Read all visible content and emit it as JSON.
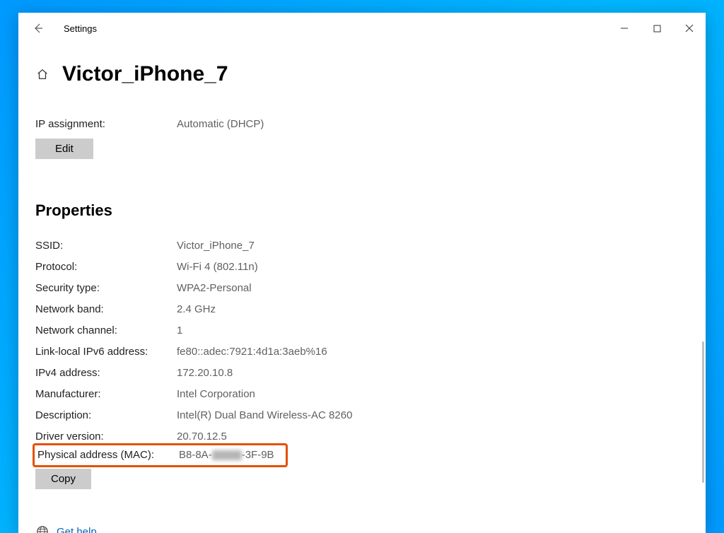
{
  "window": {
    "app_title": "Settings"
  },
  "header": {
    "page_title": "Victor_iPhone_7"
  },
  "ip_assignment": {
    "label": "IP assignment:",
    "value": "Automatic (DHCP)",
    "edit_button": "Edit"
  },
  "properties_heading": "Properties",
  "properties": [
    {
      "label": "SSID:",
      "value": "Victor_iPhone_7"
    },
    {
      "label": "Protocol:",
      "value": "Wi-Fi 4 (802.11n)"
    },
    {
      "label": "Security type:",
      "value": "WPA2-Personal"
    },
    {
      "label": "Network band:",
      "value": "2.4 GHz"
    },
    {
      "label": "Network channel:",
      "value": "1"
    },
    {
      "label": "Link-local IPv6 address:",
      "value": "fe80::adec:7921:4d1a:3aeb%16"
    },
    {
      "label": "IPv4 address:",
      "value": "172.20.10.8"
    },
    {
      "label": "Manufacturer:",
      "value": "Intel Corporation"
    },
    {
      "label": "Description:",
      "value": "Intel(R) Dual Band Wireless-AC 8260"
    },
    {
      "label": "Driver version:",
      "value": "20.70.12.5"
    }
  ],
  "mac": {
    "label": "Physical address (MAC):",
    "prefix": "B8-8A",
    "suffix": "-3F-9B"
  },
  "copy_button": "Copy",
  "help_link": "Get help"
}
